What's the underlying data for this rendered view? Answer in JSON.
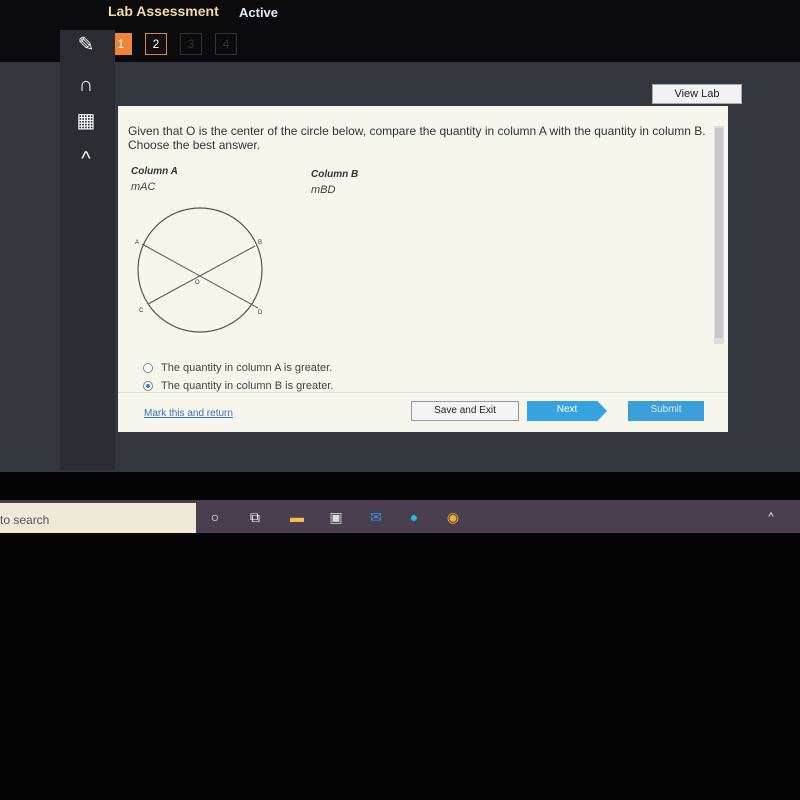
{
  "header": {
    "title": "Lab Assessment",
    "status": "Active",
    "questions": [
      "1",
      "2",
      "3",
      "4"
    ]
  },
  "sidebar": {
    "items": [
      "pencil-icon",
      "headphones-icon",
      "calculator-icon",
      "collapse-up-icon"
    ]
  },
  "view_lab": "View Lab",
  "question": {
    "text": "Given that O is the center of the circle below, compare the quantity in column A with the quantity in column B. Choose the best answer.",
    "column_a": {
      "label": "Column A",
      "value": "mAC"
    },
    "column_b": {
      "label": "Column B",
      "value": "mBD"
    },
    "figure": {
      "points": [
        "A",
        "B",
        "C",
        "D",
        "O"
      ]
    },
    "options": [
      {
        "label": "The quantity in column A is greater.",
        "selected": false
      },
      {
        "label": "The quantity in column B is greater.",
        "selected": true
      }
    ]
  },
  "footer": {
    "mark": "Mark this and return",
    "save": "Save and Exit",
    "next": "Next",
    "submit": "Submit"
  },
  "taskbar": {
    "search": "to search",
    "icons": [
      "cortana-icon",
      "task-view-icon",
      "file-explorer-icon",
      "store-icon",
      "mail-icon",
      "edge-icon",
      "chrome-icon"
    ]
  }
}
